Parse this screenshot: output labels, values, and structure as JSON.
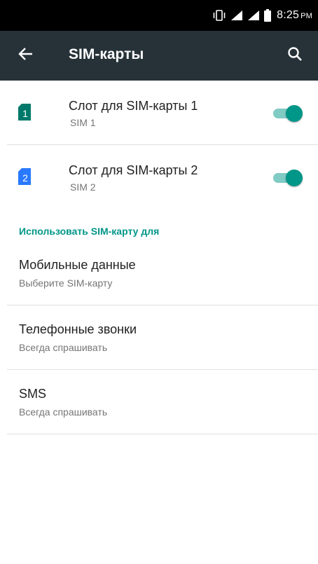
{
  "status_bar": {
    "time": "8:25",
    "ampm": "PM",
    "icons": [
      "vibrate-icon",
      "signal-icon",
      "signal-icon",
      "battery-icon"
    ]
  },
  "app_bar": {
    "title": "SIM-карты",
    "back_icon": "arrow-back-icon",
    "search_icon": "search-icon"
  },
  "sim_slots": [
    {
      "title": "Слот для SIM-карты 1",
      "subtitle": "SIM 1",
      "badge": "1",
      "badge_color": "#00796b",
      "enabled": true
    },
    {
      "title": "Слот для SIM-карты 2",
      "subtitle": "SIM 2",
      "badge": "2",
      "badge_color": "#2979ff",
      "enabled": true
    }
  ],
  "section": {
    "header": "Использовать SIM-карту для"
  },
  "preferences": [
    {
      "title": "Мобильные данные",
      "subtitle": "Выберите SIM-карту"
    },
    {
      "title": "Телефонные звонки",
      "subtitle": "Всегда спрашивать"
    },
    {
      "title": "SMS",
      "subtitle": "Всегда спрашивать"
    }
  ],
  "colors": {
    "accent": "#009688",
    "toggle_track": "#80cbc4",
    "app_bar": "#263238",
    "status_bar": "#000000"
  }
}
